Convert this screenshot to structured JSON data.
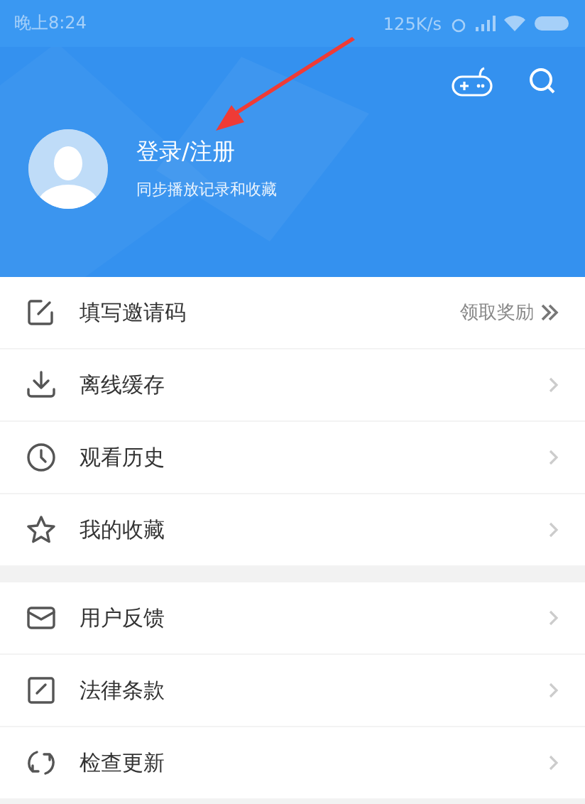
{
  "status_bar": {
    "time": "晚上8:24",
    "speed": "125K/s"
  },
  "header": {
    "title": "登录/注册",
    "subtitle": "同步播放记录和收藏"
  },
  "menu_groups": [
    {
      "items": [
        {
          "kind": "edit",
          "label": "填写邀请码",
          "extra": "领取奖励"
        },
        {
          "kind": "download",
          "label": "离线缓存"
        },
        {
          "kind": "history",
          "label": "观看历史"
        },
        {
          "kind": "star",
          "label": "我的收藏"
        }
      ]
    },
    {
      "items": [
        {
          "kind": "mail",
          "label": "用户反馈"
        },
        {
          "kind": "terms",
          "label": "法律条款"
        },
        {
          "kind": "refresh",
          "label": "检查更新"
        }
      ]
    }
  ]
}
